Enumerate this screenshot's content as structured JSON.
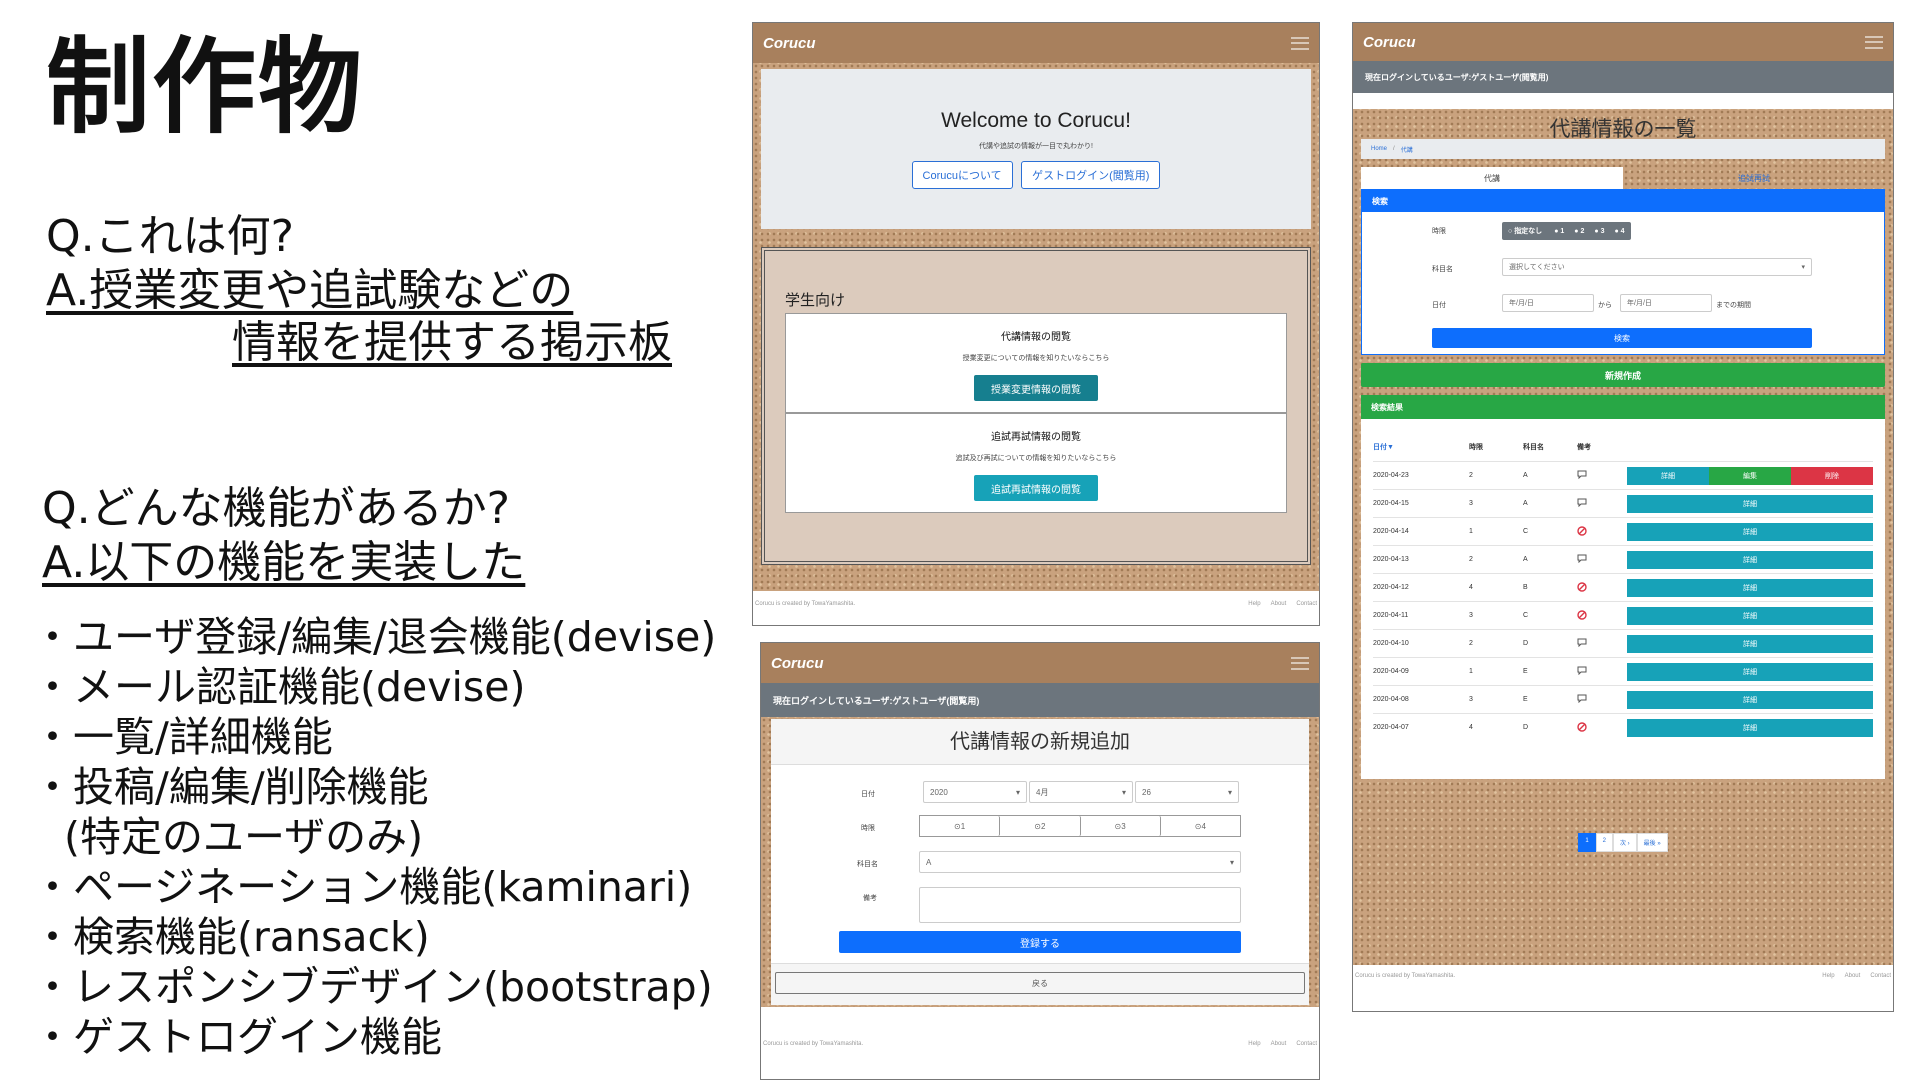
{
  "slide": {
    "title": "制作物",
    "q1": "Q.これは何?",
    "a1_line1": "A.授業変更や追試験などの",
    "a1_line2": "情報を提供する掲示板",
    "q2": "Q.どんな機能があるか?",
    "a2": "A.以下の機能を実装した",
    "features": [
      "・ユーザ登録/編集/退会機能(devise)",
      "・メール認証機能(devise)",
      "・一覧/詳細機能",
      "・投稿/編集/削除機能",
      "(特定のユーザのみ)",
      "・ページネーション機能(kaminari)",
      "・検索機能(ransack)",
      "・レスポンシブデザイン(bootstrap)",
      "・ゲストログイン機能"
    ]
  },
  "app": {
    "brand": "Corucu",
    "footer_credit": "Corucu is created by TowaYamashita.",
    "footer_links": [
      "Help",
      "About",
      "Contact"
    ],
    "login_status": "現在ログインしているユーザ:ゲストユーザ(閲覧用)"
  },
  "home": {
    "welcome": "Welcome to Corucu!",
    "tagline": "代講や追試の情報が一目で丸わかり!",
    "about_button": "Corucuについて",
    "guest_button": "ゲストログイン(閲覧用)",
    "section_title": "学生向け",
    "card1_title": "代講情報の閲覧",
    "card1_text": "授業変更についての情報を知りたいならこちら",
    "card1_button": "授業変更情報の閲覧",
    "card2_title": "追試再試情報の閲覧",
    "card2_text": "追試及び再試についての情報を知りたいならこちら",
    "card2_button": "追試再試情報の閲覧"
  },
  "newform": {
    "heading": "代講情報の新規追加",
    "date_label": "日付",
    "year": "2020",
    "month": "4月",
    "day": "26",
    "period_label": "時限",
    "periods": [
      "1",
      "2",
      "3",
      "4"
    ],
    "subject_label": "科目名",
    "subject_value": "A",
    "note_label": "備考",
    "submit": "登録する",
    "back": "戻る"
  },
  "list": {
    "heading": "代講情報の一覧",
    "breadcrumb_home": "Home",
    "breadcrumb_current": "代講",
    "tab_active": "代講",
    "tab_other": "追試再試",
    "search_header": "検索",
    "period_label": "時限",
    "period_options": [
      "指定なし",
      "1",
      "2",
      "3",
      "4"
    ],
    "subject_label": "科目名",
    "subject_placeholder": "選択してください",
    "date_label": "日付",
    "date_placeholder": "年/月/日",
    "date_from": "から",
    "date_until": "までの期間",
    "search_button": "検索",
    "new_button": "新規作成",
    "results_header": "検索結果",
    "columns": [
      "日付▼",
      "時限",
      "科目名",
      "備考"
    ],
    "rows": [
      {
        "date": "2020-04-23",
        "period": "2",
        "subject": "A",
        "note": "comment"
      },
      {
        "date": "2020-04-15",
        "period": "3",
        "subject": "A",
        "note": "comment"
      },
      {
        "date": "2020-04-14",
        "period": "1",
        "subject": "C",
        "note": "none"
      },
      {
        "date": "2020-04-13",
        "period": "2",
        "subject": "A",
        "note": "comment"
      },
      {
        "date": "2020-04-12",
        "period": "4",
        "subject": "B",
        "note": "none"
      },
      {
        "date": "2020-04-11",
        "period": "3",
        "subject": "C",
        "note": "none"
      },
      {
        "date": "2020-04-10",
        "period": "2",
        "subject": "D",
        "note": "comment"
      },
      {
        "date": "2020-04-09",
        "period": "1",
        "subject": "E",
        "note": "comment"
      },
      {
        "date": "2020-04-08",
        "period": "3",
        "subject": "E",
        "note": "comment"
      },
      {
        "date": "2020-04-07",
        "period": "4",
        "subject": "D",
        "note": "none"
      }
    ],
    "detail": "詳細",
    "edit": "編集",
    "delete": "削除",
    "pages": [
      "1",
      "2",
      "次 ›",
      "最後 »"
    ]
  }
}
